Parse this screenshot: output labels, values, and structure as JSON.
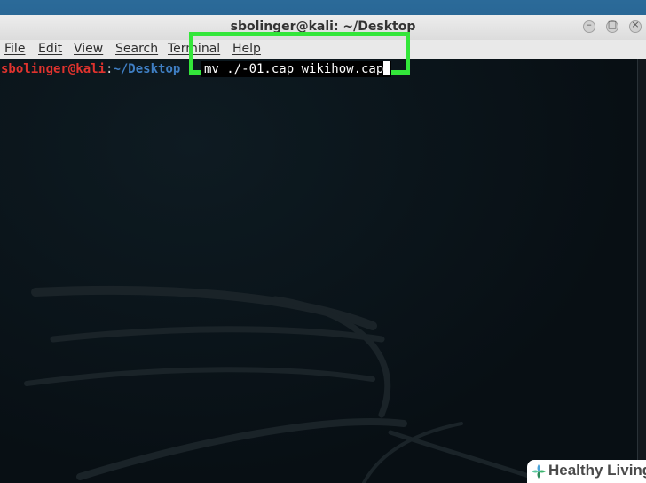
{
  "window": {
    "title": "sbolinger@kali: ~/Desktop",
    "controls": {
      "minimize": "–",
      "maximize": "□",
      "close": "×"
    }
  },
  "menubar": {
    "items": [
      {
        "label": "File"
      },
      {
        "label": "Edit"
      },
      {
        "label": "View"
      },
      {
        "label": "Search"
      },
      {
        "label": "Terminal"
      },
      {
        "label": "Help"
      }
    ]
  },
  "terminal": {
    "prompt_user": "sbolinger@kali",
    "prompt_colon": ":",
    "prompt_path": "~/Desktop",
    "command": "mv ./-01.cap wikihow.cap"
  },
  "badge": {
    "text": "Healthy Living"
  },
  "colors": {
    "highlight": "#33e63a",
    "prompt_user": "#e0332e",
    "prompt_path": "#3f7fc4"
  },
  "icons": {
    "badge_icon": "plus-cross-icon"
  }
}
